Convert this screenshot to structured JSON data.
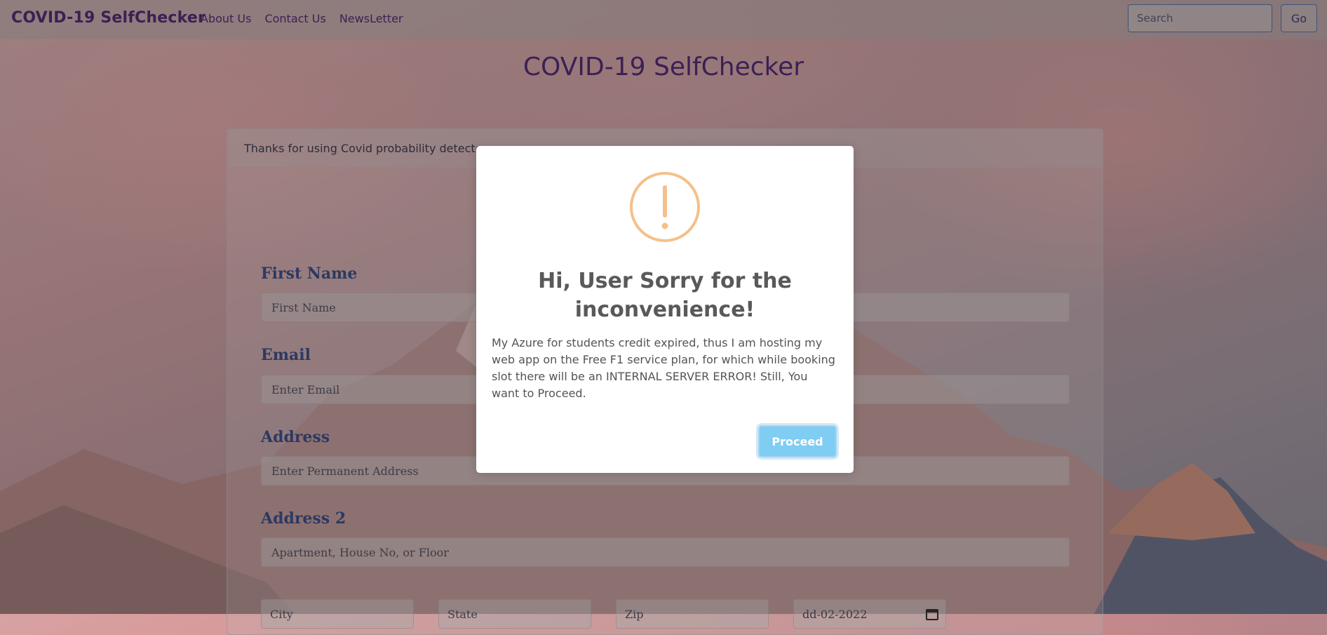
{
  "navbar": {
    "brand": "COVID-19 SelfChecker",
    "links": [
      "About Us",
      "Contact Us",
      "NewsLetter"
    ],
    "search_placeholder": "Search",
    "go_label": "Go"
  },
  "page_title": "COVID-19 SelfChecker",
  "card": {
    "header_text": "Thanks for using Covid probability detector",
    "fields": [
      {
        "label": "First Name",
        "placeholder": "First Name"
      },
      {
        "label": "Email",
        "placeholder": "Enter Email"
      },
      {
        "label": "Address",
        "placeholder": "Enter Permanent Address"
      },
      {
        "label": "Address 2",
        "placeholder": "Apartment, House No, or Floor"
      }
    ],
    "bottom_row": {
      "city_placeholder": "City",
      "state_placeholder": "State",
      "zip_placeholder": "Zip",
      "date_value": "dd-02-2022"
    }
  },
  "modal": {
    "icon": "warning-exclamation-icon",
    "title": "Hi, User Sorry for the inconvenience!",
    "text": "My Azure for students credit expired, thus I am hosting my web app on the Free F1 service plan, for which while booking slot there will be an INTERNAL SERVER ERROR! Still, You want to Proceed.",
    "proceed_label": "Proceed",
    "accent_color": "#f5c08b",
    "button_color": "#7fcdf3"
  }
}
